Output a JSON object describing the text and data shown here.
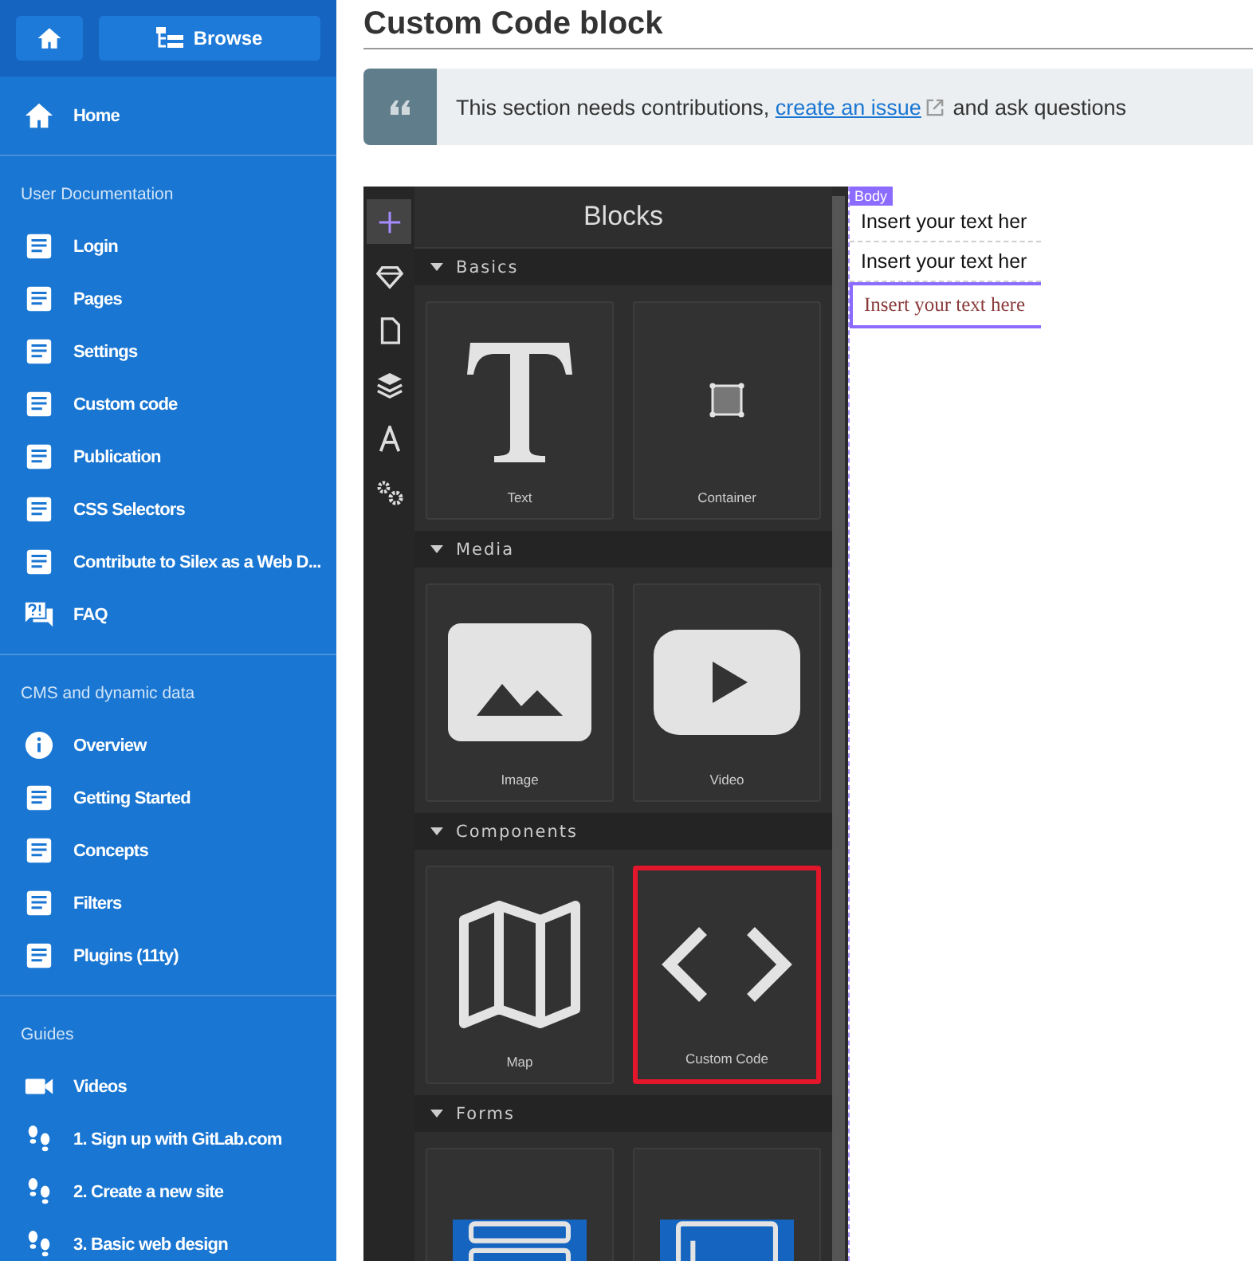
{
  "sidebar": {
    "browse_label": "Browse",
    "groups": [
      {
        "items": [
          {
            "kind": "home",
            "label": "Home"
          }
        ]
      },
      {
        "label": "User Documentation",
        "items": [
          {
            "kind": "doc",
            "label": "Login"
          },
          {
            "kind": "doc",
            "label": "Pages"
          },
          {
            "kind": "doc",
            "label": "Settings"
          },
          {
            "kind": "doc",
            "label": "Custom code"
          },
          {
            "kind": "doc",
            "label": "Publication"
          },
          {
            "kind": "doc",
            "label": "CSS Selectors"
          },
          {
            "kind": "doc",
            "label": "Contribute to Silex as a Web D..."
          },
          {
            "kind": "faq",
            "label": "FAQ"
          }
        ]
      },
      {
        "label": "CMS and dynamic data",
        "items": [
          {
            "kind": "info",
            "label": "Overview"
          },
          {
            "kind": "doc",
            "label": "Getting Started"
          },
          {
            "kind": "doc",
            "label": "Concepts"
          },
          {
            "kind": "doc",
            "label": "Filters"
          },
          {
            "kind": "doc",
            "label": "Plugins (11ty)"
          }
        ]
      },
      {
        "label": "Guides",
        "items": [
          {
            "kind": "video",
            "label": "Videos"
          },
          {
            "kind": "steps",
            "label": "1. Sign up with GitLab.com"
          },
          {
            "kind": "steps",
            "label": "2. Create a new site"
          },
          {
            "kind": "steps",
            "label": "3. Basic web design"
          }
        ]
      }
    ]
  },
  "page": {
    "title": "Custom Code block",
    "notice": {
      "text_before": "This section needs contributions,",
      "link": "create an issue",
      "text_after": "and ask questions"
    }
  },
  "screenshot": {
    "tools": [
      {
        "kind": "plus",
        "selected": true
      },
      {
        "kind": "gem",
        "selected": false
      },
      {
        "kind": "page",
        "selected": false
      },
      {
        "kind": "layers",
        "selected": false
      },
      {
        "kind": "font",
        "selected": false
      },
      {
        "kind": "gears",
        "selected": false
      }
    ],
    "panel_title": "Blocks",
    "categories": [
      {
        "label": "Basics",
        "expanded": true,
        "blocks": [
          {
            "kind": "text",
            "label": "Text",
            "selected": false
          },
          {
            "kind": "container",
            "label": "Container",
            "selected": false
          }
        ]
      },
      {
        "label": "Media",
        "expanded": true,
        "blocks": [
          {
            "kind": "image",
            "label": "Image",
            "selected": false
          },
          {
            "kind": "video",
            "label": "Video",
            "selected": false
          }
        ]
      },
      {
        "label": "Components",
        "expanded": true,
        "blocks": [
          {
            "kind": "map",
            "label": "Map",
            "selected": false
          },
          {
            "kind": "code",
            "label": "Custom Code",
            "selected": true
          }
        ]
      },
      {
        "label": "Forms",
        "expanded": true,
        "blocks": [
          {
            "kind": "form",
            "selected": false
          },
          {
            "kind": "input",
            "selected": false
          }
        ]
      }
    ],
    "canvas": {
      "badge": "Body",
      "elements": [
        {
          "kind": "sans",
          "text": "Insert your text her",
          "selected": false
        },
        {
          "kind": "sans",
          "text": "Insert your text her",
          "selected": false
        },
        {
          "kind": "serif",
          "text": "Insert your text here",
          "selected": true
        }
      ]
    }
  }
}
